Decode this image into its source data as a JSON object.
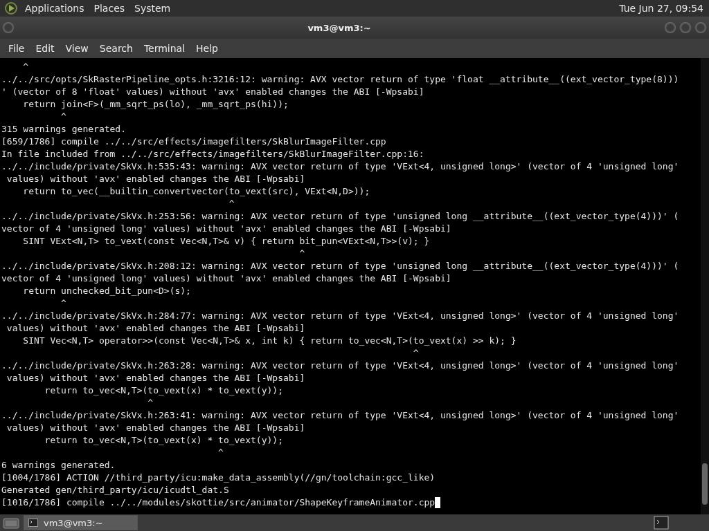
{
  "top_panel": {
    "menus": [
      "Applications",
      "Places",
      "System"
    ],
    "clock": "Tue Jun 27, 09:54"
  },
  "window": {
    "title": "vm3@vm3:~"
  },
  "menu_bar": [
    "File",
    "Edit",
    "View",
    "Search",
    "Terminal",
    "Help"
  ],
  "terminal": {
    "lines": [
      "    ^",
      "../../src/opts/SkRasterPipeline_opts.h:3216:12: warning: AVX vector return of type 'float __attribute__((ext_vector_type(8)))",
      "' (vector of 8 'float' values) without 'avx' enabled changes the ABI [-Wpsabi]",
      "    return join<F>(_mm_sqrt_ps(lo), _mm_sqrt_ps(hi));",
      "           ^",
      "315 warnings generated.",
      "[659/1786] compile ../../src/effects/imagefilters/SkBlurImageFilter.cpp",
      "In file included from ../../src/effects/imagefilters/SkBlurImageFilter.cpp:16:",
      "../../include/private/SkVx.h:535:43: warning: AVX vector return of type 'VExt<4, unsigned long>' (vector of 4 'unsigned long'",
      " values) without 'avx' enabled changes the ABI [-Wpsabi]",
      "    return to_vec(__builtin_convertvector(to_vext(src), VExt<N,D>));",
      "                                          ^",
      "../../include/private/SkVx.h:253:56: warning: AVX vector return of type 'unsigned long __attribute__((ext_vector_type(4)))' (",
      "vector of 4 'unsigned long' values) without 'avx' enabled changes the ABI [-Wpsabi]",
      "    SINT VExt<N,T> to_vext(const Vec<N,T>& v) { return bit_pun<VExt<N,T>>(v); }",
      "                                                       ^",
      "../../include/private/SkVx.h:208:12: warning: AVX vector return of type 'unsigned long __attribute__((ext_vector_type(4)))' (",
      "vector of 4 'unsigned long' values) without 'avx' enabled changes the ABI [-Wpsabi]",
      "    return unchecked_bit_pun<D>(s);",
      "           ^",
      "../../include/private/SkVx.h:284:77: warning: AVX vector return of type 'VExt<4, unsigned long>' (vector of 4 'unsigned long'",
      " values) without 'avx' enabled changes the ABI [-Wpsabi]",
      "    SINT Vec<N,T> operator>>(const Vec<N,T>& x, int k) { return to_vec<N,T>(to_vext(x) >> k); }",
      "                                                                            ^",
      "../../include/private/SkVx.h:263:28: warning: AVX vector return of type 'VExt<4, unsigned long>' (vector of 4 'unsigned long'",
      " values) without 'avx' enabled changes the ABI [-Wpsabi]",
      "        return to_vec<N,T>(to_vext(x) * to_vext(y));",
      "                           ^",
      "../../include/private/SkVx.h:263:41: warning: AVX vector return of type 'VExt<4, unsigned long>' (vector of 4 'unsigned long'",
      " values) without 'avx' enabled changes the ABI [-Wpsabi]",
      "        return to_vec<N,T>(to_vext(x) * to_vext(y));",
      "                                        ^",
      "6 warnings generated.",
      "[1004/1786] ACTION //third_party/icu:make_data_assembly(//gn/toolchain:gcc_like)",
      "Generated gen/third_party/icu/icudtl_dat.S",
      "[1016/1786] compile ../../modules/skottie/src/animator/ShapeKeyframeAnimator.cpp"
    ]
  },
  "taskbar": {
    "tasks": [
      {
        "label": "vm3@vm3:~",
        "selected": true
      }
    ]
  }
}
